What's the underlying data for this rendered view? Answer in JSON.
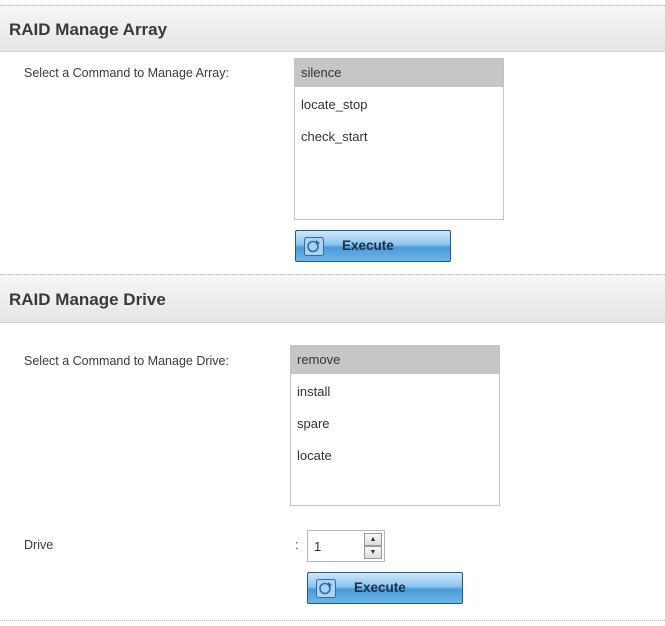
{
  "array_section": {
    "title": "RAID Manage Array",
    "command_label": "Select a Command to Manage Array:",
    "commands": [
      "silence",
      "locate_stop",
      "check_start"
    ],
    "selected_command": "silence",
    "execute_label": "Execute"
  },
  "drive_section": {
    "title": "RAID Manage Drive",
    "command_label": "Select a Command to Manage Drive:",
    "commands": [
      "remove",
      "install",
      "spare",
      "locate"
    ],
    "selected_command": "remove",
    "drive_label": "Drive",
    "drive_separator": ":",
    "drive_value": "1",
    "execute_label": "Execute"
  },
  "icons": {
    "execute": "execute-icon",
    "spin_up": "chevron-up-icon",
    "spin_down": "chevron-down-icon"
  },
  "colors": {
    "header_bg": "#ececec",
    "selected_item_bg": "#c6c6c6",
    "button_blue": "#4a9ad8",
    "button_border": "#1a5c8c"
  }
}
